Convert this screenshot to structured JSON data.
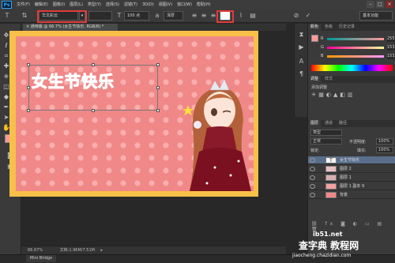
{
  "app": {
    "logo": "Ps"
  },
  "menubar": {
    "items": [
      "文件(F)",
      "编辑(E)",
      "图像(I)",
      "图层(L)",
      "类型(Y)",
      "选择(S)",
      "滤镜(T)",
      "3D(D)",
      "视图(V)",
      "窗口(W)",
      "帮助(H)"
    ]
  },
  "options": {
    "font_family": "华文彩云",
    "font_size": "100 点",
    "antialias": "浑厚",
    "workspace": "基本功能"
  },
  "document": {
    "tab_title": "× 通用版 @ 66.7% (女生节快乐, RGB/8) *",
    "banner_text": "女生节快乐",
    "zoom": "66.67%",
    "doc_size": "文档:1.96M/7.51M"
  },
  "bottom": {
    "mini_bridge": "Mini Bridge"
  },
  "right_panel": {
    "color_tabs": [
      "颜色",
      "色板",
      "历史记录"
    ],
    "rgb": [
      {
        "label": "R",
        "value": "255"
      },
      {
        "label": "G",
        "value": "153"
      },
      {
        "label": "B",
        "value": "153"
      }
    ],
    "adjust_tabs": [
      "调整",
      "样式"
    ],
    "adjust_hint": "添加调整",
    "layers_tabs": [
      "图层",
      "通道",
      "路径"
    ],
    "kind_label": "类型",
    "blend_mode": "正常",
    "opacity_label": "不透明度:",
    "opacity": "100%",
    "lock_label": "锁定:",
    "fill_label": "填充:",
    "fill": "100%",
    "layers": [
      {
        "name": "女生节快乐",
        "thumb": "T",
        "selected": true
      },
      {
        "name": "图层 2",
        "thumb": "",
        "selected": false
      },
      {
        "name": "图层 1",
        "thumb": "",
        "selected": false
      },
      {
        "name": "图层 1 副本 9",
        "thumb": "",
        "selected": false
      },
      {
        "name": "背景",
        "thumb": "",
        "selected": false
      }
    ]
  },
  "watermark": {
    "line1": "ib51.net",
    "line2": "查字典 教程网",
    "line3": "jiaocheng.chazidian.com"
  },
  "colors": {
    "foreground": "#ff9999",
    "background": "#ffffff",
    "canvas_bg": "#f08888",
    "frame": "#f8c048",
    "highlight": "#e23a3a"
  }
}
